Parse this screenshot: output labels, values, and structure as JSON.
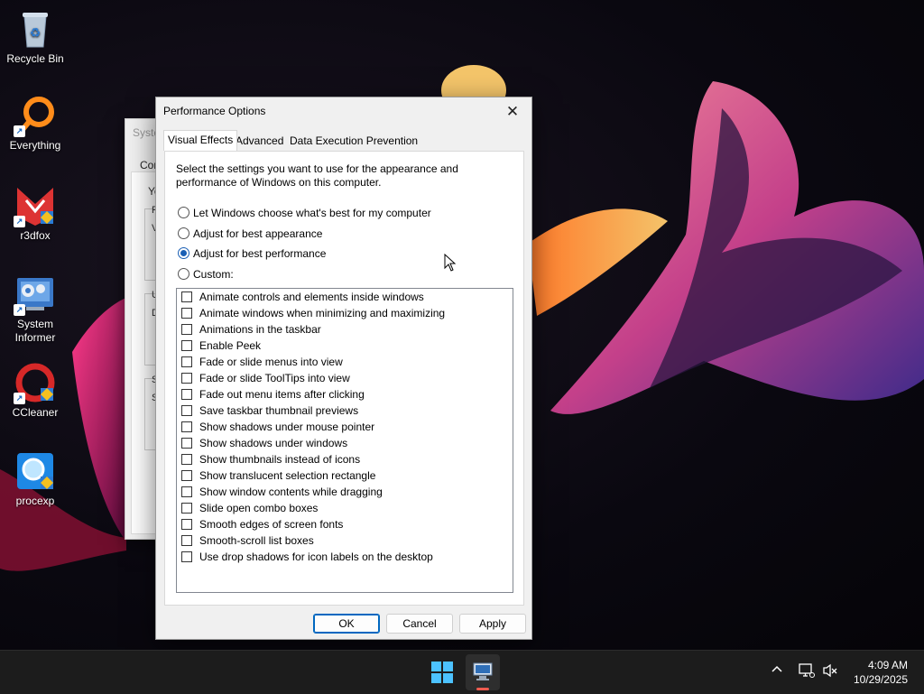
{
  "desktop": {
    "icons": [
      {
        "label": "Recycle Bin",
        "icon": "recycle-bin-icon"
      },
      {
        "label": "Everything",
        "icon": "everything-search-icon"
      },
      {
        "label": "r3dfox",
        "icon": "r3dfox-browser-icon"
      },
      {
        "label": "System Informer",
        "icon": "system-informer-icon"
      },
      {
        "label": "CCleaner",
        "icon": "ccleaner-icon"
      },
      {
        "label": "procexp",
        "icon": "process-explorer-icon"
      }
    ]
  },
  "background_window": {
    "title": "Syste",
    "tab": "Com",
    "fragments": [
      "Yo",
      "P",
      "V",
      "U",
      "D",
      "S",
      "S"
    ]
  },
  "dialog": {
    "title": "Performance Options",
    "close_glyph": "✕",
    "tabs": [
      "Visual Effects",
      "Advanced",
      "Data Execution Prevention"
    ],
    "active_tab": "Visual Effects",
    "intro": "Select the settings you want to use for the appearance and performance of Windows on this computer.",
    "radios": [
      {
        "label": "Let Windows choose what's best for my computer",
        "checked": false
      },
      {
        "label": "Adjust for best appearance",
        "checked": false
      },
      {
        "label": "Adjust for best performance",
        "checked": true
      },
      {
        "label": "Custom:",
        "checked": false
      }
    ],
    "effects": [
      {
        "label": "Animate controls and elements inside windows",
        "checked": false
      },
      {
        "label": "Animate windows when minimizing and maximizing",
        "checked": false
      },
      {
        "label": "Animations in the taskbar",
        "checked": false
      },
      {
        "label": "Enable Peek",
        "checked": false
      },
      {
        "label": "Fade or slide menus into view",
        "checked": false
      },
      {
        "label": "Fade or slide ToolTips into view",
        "checked": false
      },
      {
        "label": "Fade out menu items after clicking",
        "checked": false
      },
      {
        "label": "Save taskbar thumbnail previews",
        "checked": false
      },
      {
        "label": "Show shadows under mouse pointer",
        "checked": false
      },
      {
        "label": "Show shadows under windows",
        "checked": false
      },
      {
        "label": "Show thumbnails instead of icons",
        "checked": false
      },
      {
        "label": "Show translucent selection rectangle",
        "checked": false
      },
      {
        "label": "Show window contents while dragging",
        "checked": false
      },
      {
        "label": "Slide open combo boxes",
        "checked": false
      },
      {
        "label": "Smooth edges of screen fonts",
        "checked": false
      },
      {
        "label": "Smooth-scroll list boxes",
        "checked": false
      },
      {
        "label": "Use drop shadows for icon labels on the desktop",
        "checked": false
      }
    ],
    "buttons": {
      "ok": "OK",
      "cancel": "Cancel",
      "apply": "Apply"
    }
  },
  "taskbar": {
    "start_icon": "windows-start-icon",
    "pinned_app_icon": "system-properties-icon",
    "tray": {
      "overflow_glyph": "^",
      "icons": [
        "network-icon",
        "volume-muted-icon"
      ]
    },
    "clock": {
      "time": "4:09 AM",
      "date": "10/29/2025"
    }
  },
  "colors": {
    "accent": "#1a5fb4",
    "taskbar_indicator": "#ef5b4f",
    "taskbar_bg": "#1c1c1c"
  }
}
